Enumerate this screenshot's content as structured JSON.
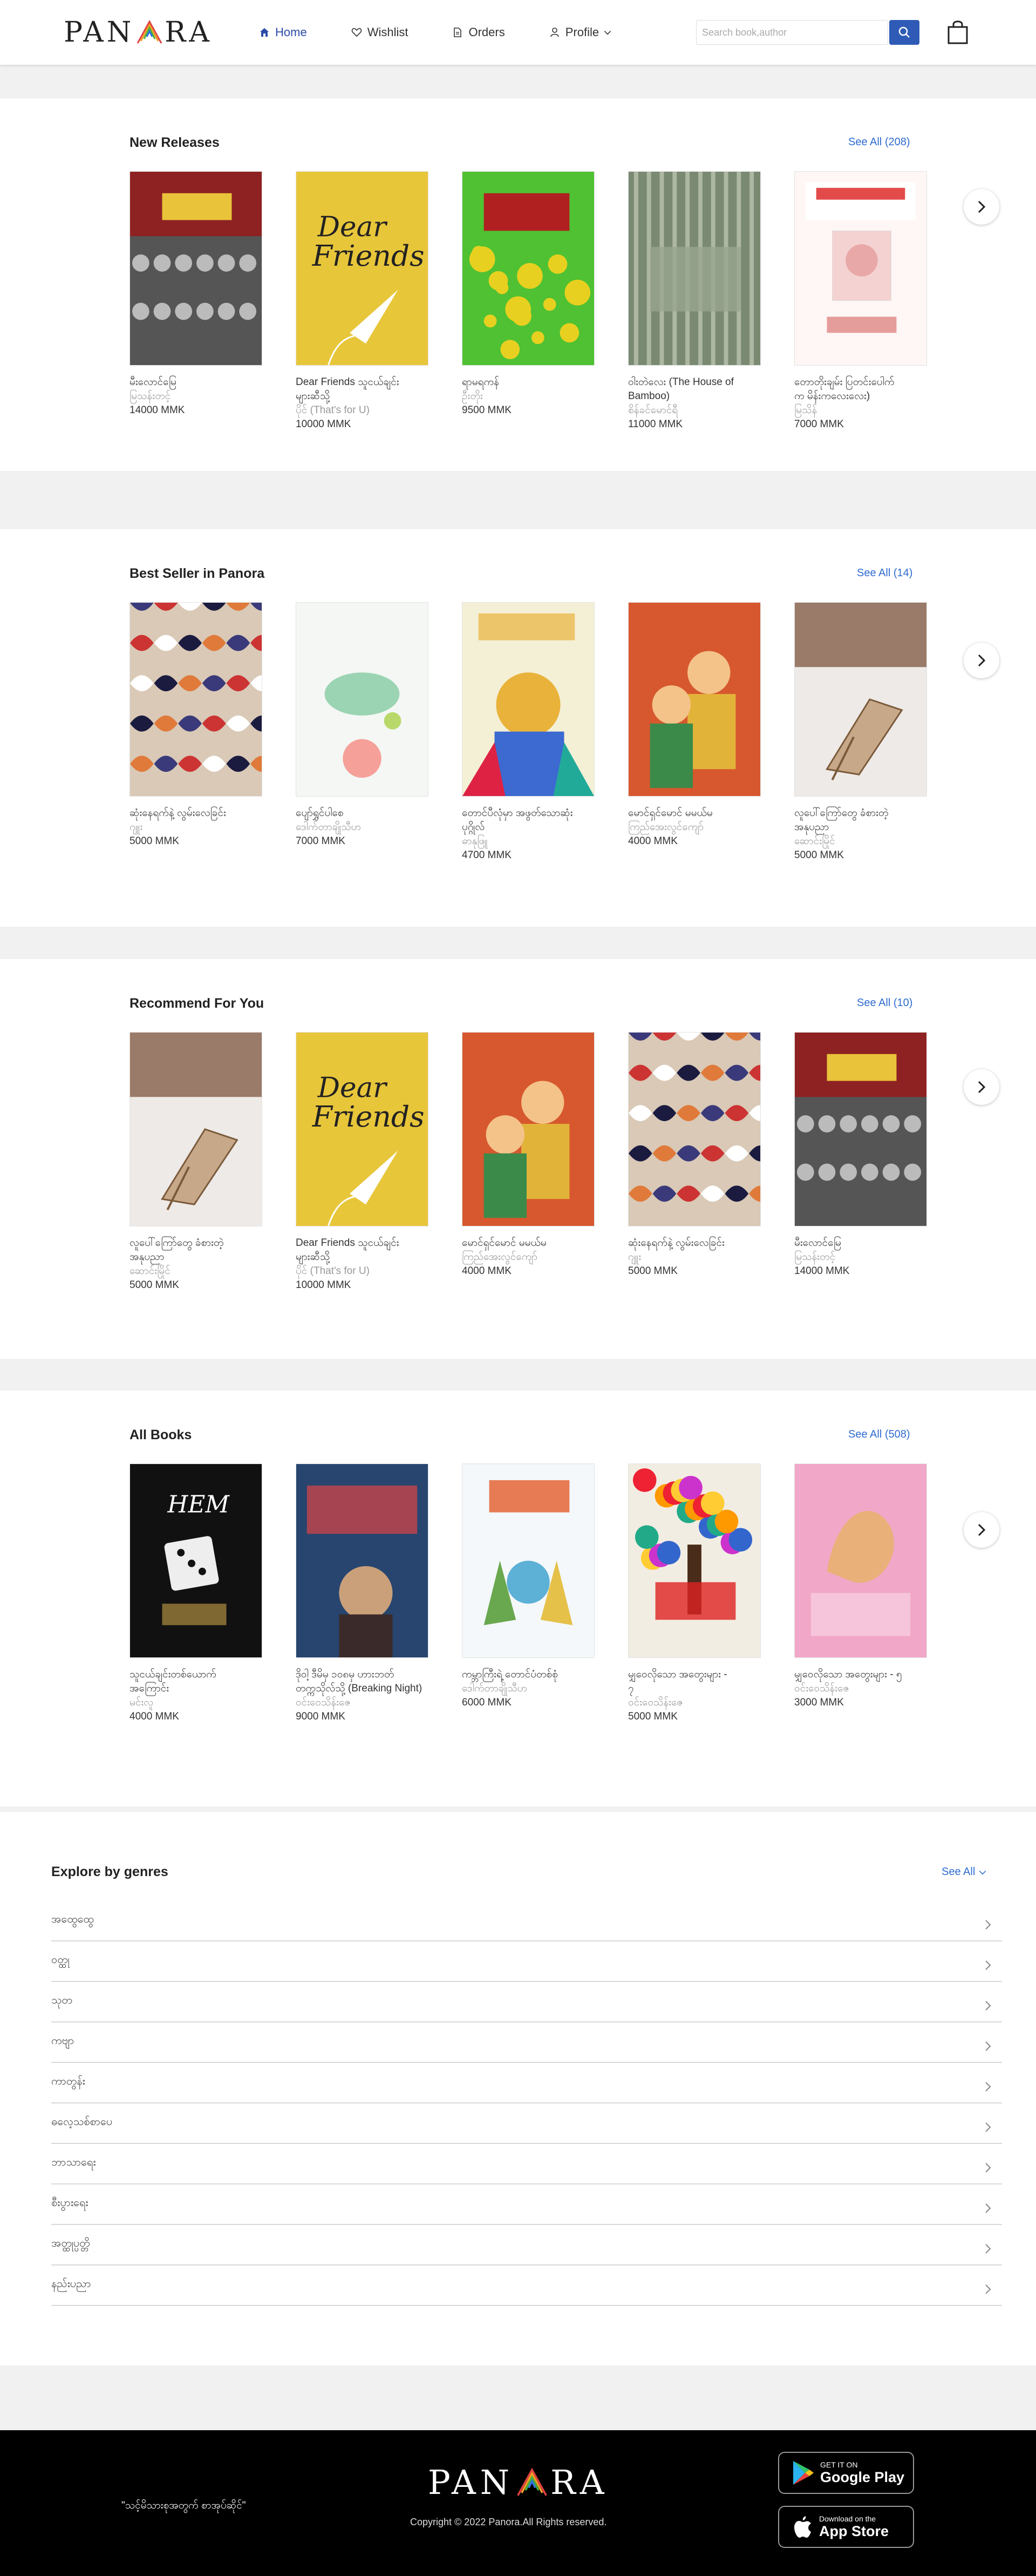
{
  "brand": {
    "logo_left": "PAN",
    "logo_right": "RA"
  },
  "nav": {
    "home": "Home",
    "wishlist": "Wishlist",
    "orders": "Orders",
    "profile": "Profile",
    "search_placeholder": "Search book,author"
  },
  "sections": [
    {
      "title": "New Releases",
      "see_all": "See All (208)",
      "books": [
        {
          "title": "မီးလောင်မြေ",
          "title2": "",
          "author": "မြသန်းတင့်",
          "price": "14000 MMK",
          "cover": "red-soldiers"
        },
        {
          "title": "Dear Friends သူငယ်ချင်း",
          "title2": "များဆီသို့",
          "author": "ပိုင် (That's for U)",
          "price": "10000 MMK",
          "cover": "yellow-friends"
        },
        {
          "title": "ရာမရကန်",
          "title2": "",
          "author": "ဦးတိုး",
          "price": "9500 MMK",
          "cover": "green-rama"
        },
        {
          "title": "ဝါးတဲလေး (The House of",
          "title2": "Bamboo)",
          "author": "စိန်ခင်မောင်ရီ",
          "price": "11000 MMK",
          "cover": "bamboo"
        },
        {
          "title": "တောတိုးချမ်း ပြတင်းပေါက်",
          "title2": "က မိန်းကလေးလေး)",
          "author": "မြသိန်",
          "price": "7000 MMK",
          "cover": "totto"
        }
      ]
    },
    {
      "title": "Best Seller in Panora",
      "see_all": "See All (14)",
      "books": [
        {
          "title": "ဆုံးနေရက်နဲ့ လွမ်းလေခြင်း",
          "title2": "",
          "author": "ဂျူး",
          "price": "5000 MMK",
          "cover": "pattern"
        },
        {
          "title": "ပျော်ရွှင်ပါစေ",
          "title2": "",
          "author": "ဒေါက်တာချိုသီဟ",
          "price": "7000 MMK",
          "cover": "happy"
        },
        {
          "title": "တောင်ပီလုံမှာ အဖွတ်သောဆုံး",
          "title2": "ပုဂ္ဂိုလ်",
          "author": "ဓာနုဖြူ",
          "price": "4700 MMK",
          "cover": "colorful-man"
        },
        {
          "title": "မောင်ရှင်မောင် မမယ်မ",
          "title2": "",
          "author": "ကြည်အေးလွင်ကျော်",
          "price": "4000 MMK",
          "cover": "couple"
        },
        {
          "title": "လူပေါ်ကြော်တွေ ခံစားတဲ့",
          "title2": "အနုပညာ",
          "author": "ဆောင်းမြိုင်",
          "price": "5000 MMK",
          "cover": "chair"
        }
      ]
    },
    {
      "title": "Recommend For You",
      "see_all": "See All (10)",
      "books": [
        {
          "title": "လူပေါ်ကြော်တွေ ခံစားတဲ့",
          "title2": "အနုပညာ",
          "author": "ဆောင်းမြိုင်",
          "price": "5000 MMK",
          "cover": "chair"
        },
        {
          "title": "Dear Friends သူငယ်ချင်း",
          "title2": "များဆီသို့",
          "author": "ပိုင် (That's for U)",
          "price": "10000 MMK",
          "cover": "yellow-friends"
        },
        {
          "title": "မောင်ရှင်မောင် မမယ်မ",
          "title2": "",
          "author": "ကြည်အေးလွင်ကျော်",
          "price": "4000 MMK",
          "cover": "couple"
        },
        {
          "title": "ဆုံးနေရက်နဲ့ လွမ်းလေခြင်း",
          "title2": "",
          "author": "ဂျူး",
          "price": "5000 MMK",
          "cover": "pattern"
        },
        {
          "title": "မီးလောင်မြေ",
          "title2": "",
          "author": "မြသန်းတင့်",
          "price": "14000 MMK",
          "cover": "red-soldiers"
        }
      ]
    },
    {
      "title": "All Books",
      "see_all": "See All (508)",
      "books": [
        {
          "title": "သူငယ်ချင်းတစ်ယောက်",
          "title2": "အကြောင်း",
          "author": "မင်းလူ",
          "price": "4000 MMK",
          "cover": "dice"
        },
        {
          "title": "ဒိုဝါ့ ဒီမိမှ ၁၀၈မှ ဟားဘတ်",
          "title2": "တက္ကသိုလ်သို့ (Breaking Night)",
          "author": "ဝင်းဝေသိန်းဇေ",
          "price": "9000 MMK",
          "cover": "night"
        },
        {
          "title": "ကမ္ဘာကြီးရဲ့ တောင်ပံတစ်စုံ",
          "title2": "",
          "author": "ဒေါက်တာချိုသီဟ",
          "price": "6000 MMK",
          "cover": "hands"
        },
        {
          "title": "မျှဝေလိုသော အတွေးများ -",
          "title2": "၇",
          "author": "ဝင်းဝေသိန်းဇေ",
          "price": "5000 MMK",
          "cover": "tree"
        },
        {
          "title": "မျှဝေလိုသော အတွေးများ - ၅",
          "title2": "",
          "author": "ဝင်းဝေသိန်းဇေ",
          "price": "3000 MMK",
          "cover": "pink-hands"
        }
      ]
    }
  ],
  "genres": {
    "title": "Explore by genres",
    "see_all": "See All",
    "items": [
      "အထွေထွေ",
      "ဝတ္ထု",
      "သုတ",
      "ကဗျာ",
      "ကာတွန်း",
      "ဓလေ့သစ်စာပေ",
      "ဘာသာရေး",
      "စီးပွားရေး",
      "အတ္ထုပ္ပတ္တိ",
      "နည်းပညာ"
    ]
  },
  "footer": {
    "quote": "\"သင့်မိသားစုအတွက် စာအုပ်ဆိုင်\"",
    "logo_left": "PAN",
    "logo_right": "RA",
    "copyright": "Copyright © 2022 Panora.All Rights reserved.",
    "google_small": "GET IT ON",
    "google_big": "Google Play",
    "apple_small": "Download on the",
    "apple_big": "App Store"
  }
}
